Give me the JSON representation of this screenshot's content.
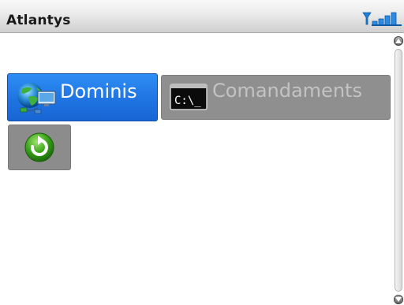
{
  "header": {
    "title": "Atlantys",
    "signal_icon": "signal-strength-icon"
  },
  "tabs": [
    {
      "label": "Dominis",
      "icon": "globe-network-icon",
      "selected": true
    },
    {
      "label": "Comandaments",
      "icon": "command-prompt-icon",
      "prompt_text": "C:\\_",
      "selected": false
    }
  ],
  "actions": {
    "refresh_icon": "refresh-icon"
  },
  "colors": {
    "selected_tab": "#1f74e2",
    "unselected_tab": "#8f8f8f",
    "refresh_green": "#3aa51a"
  }
}
